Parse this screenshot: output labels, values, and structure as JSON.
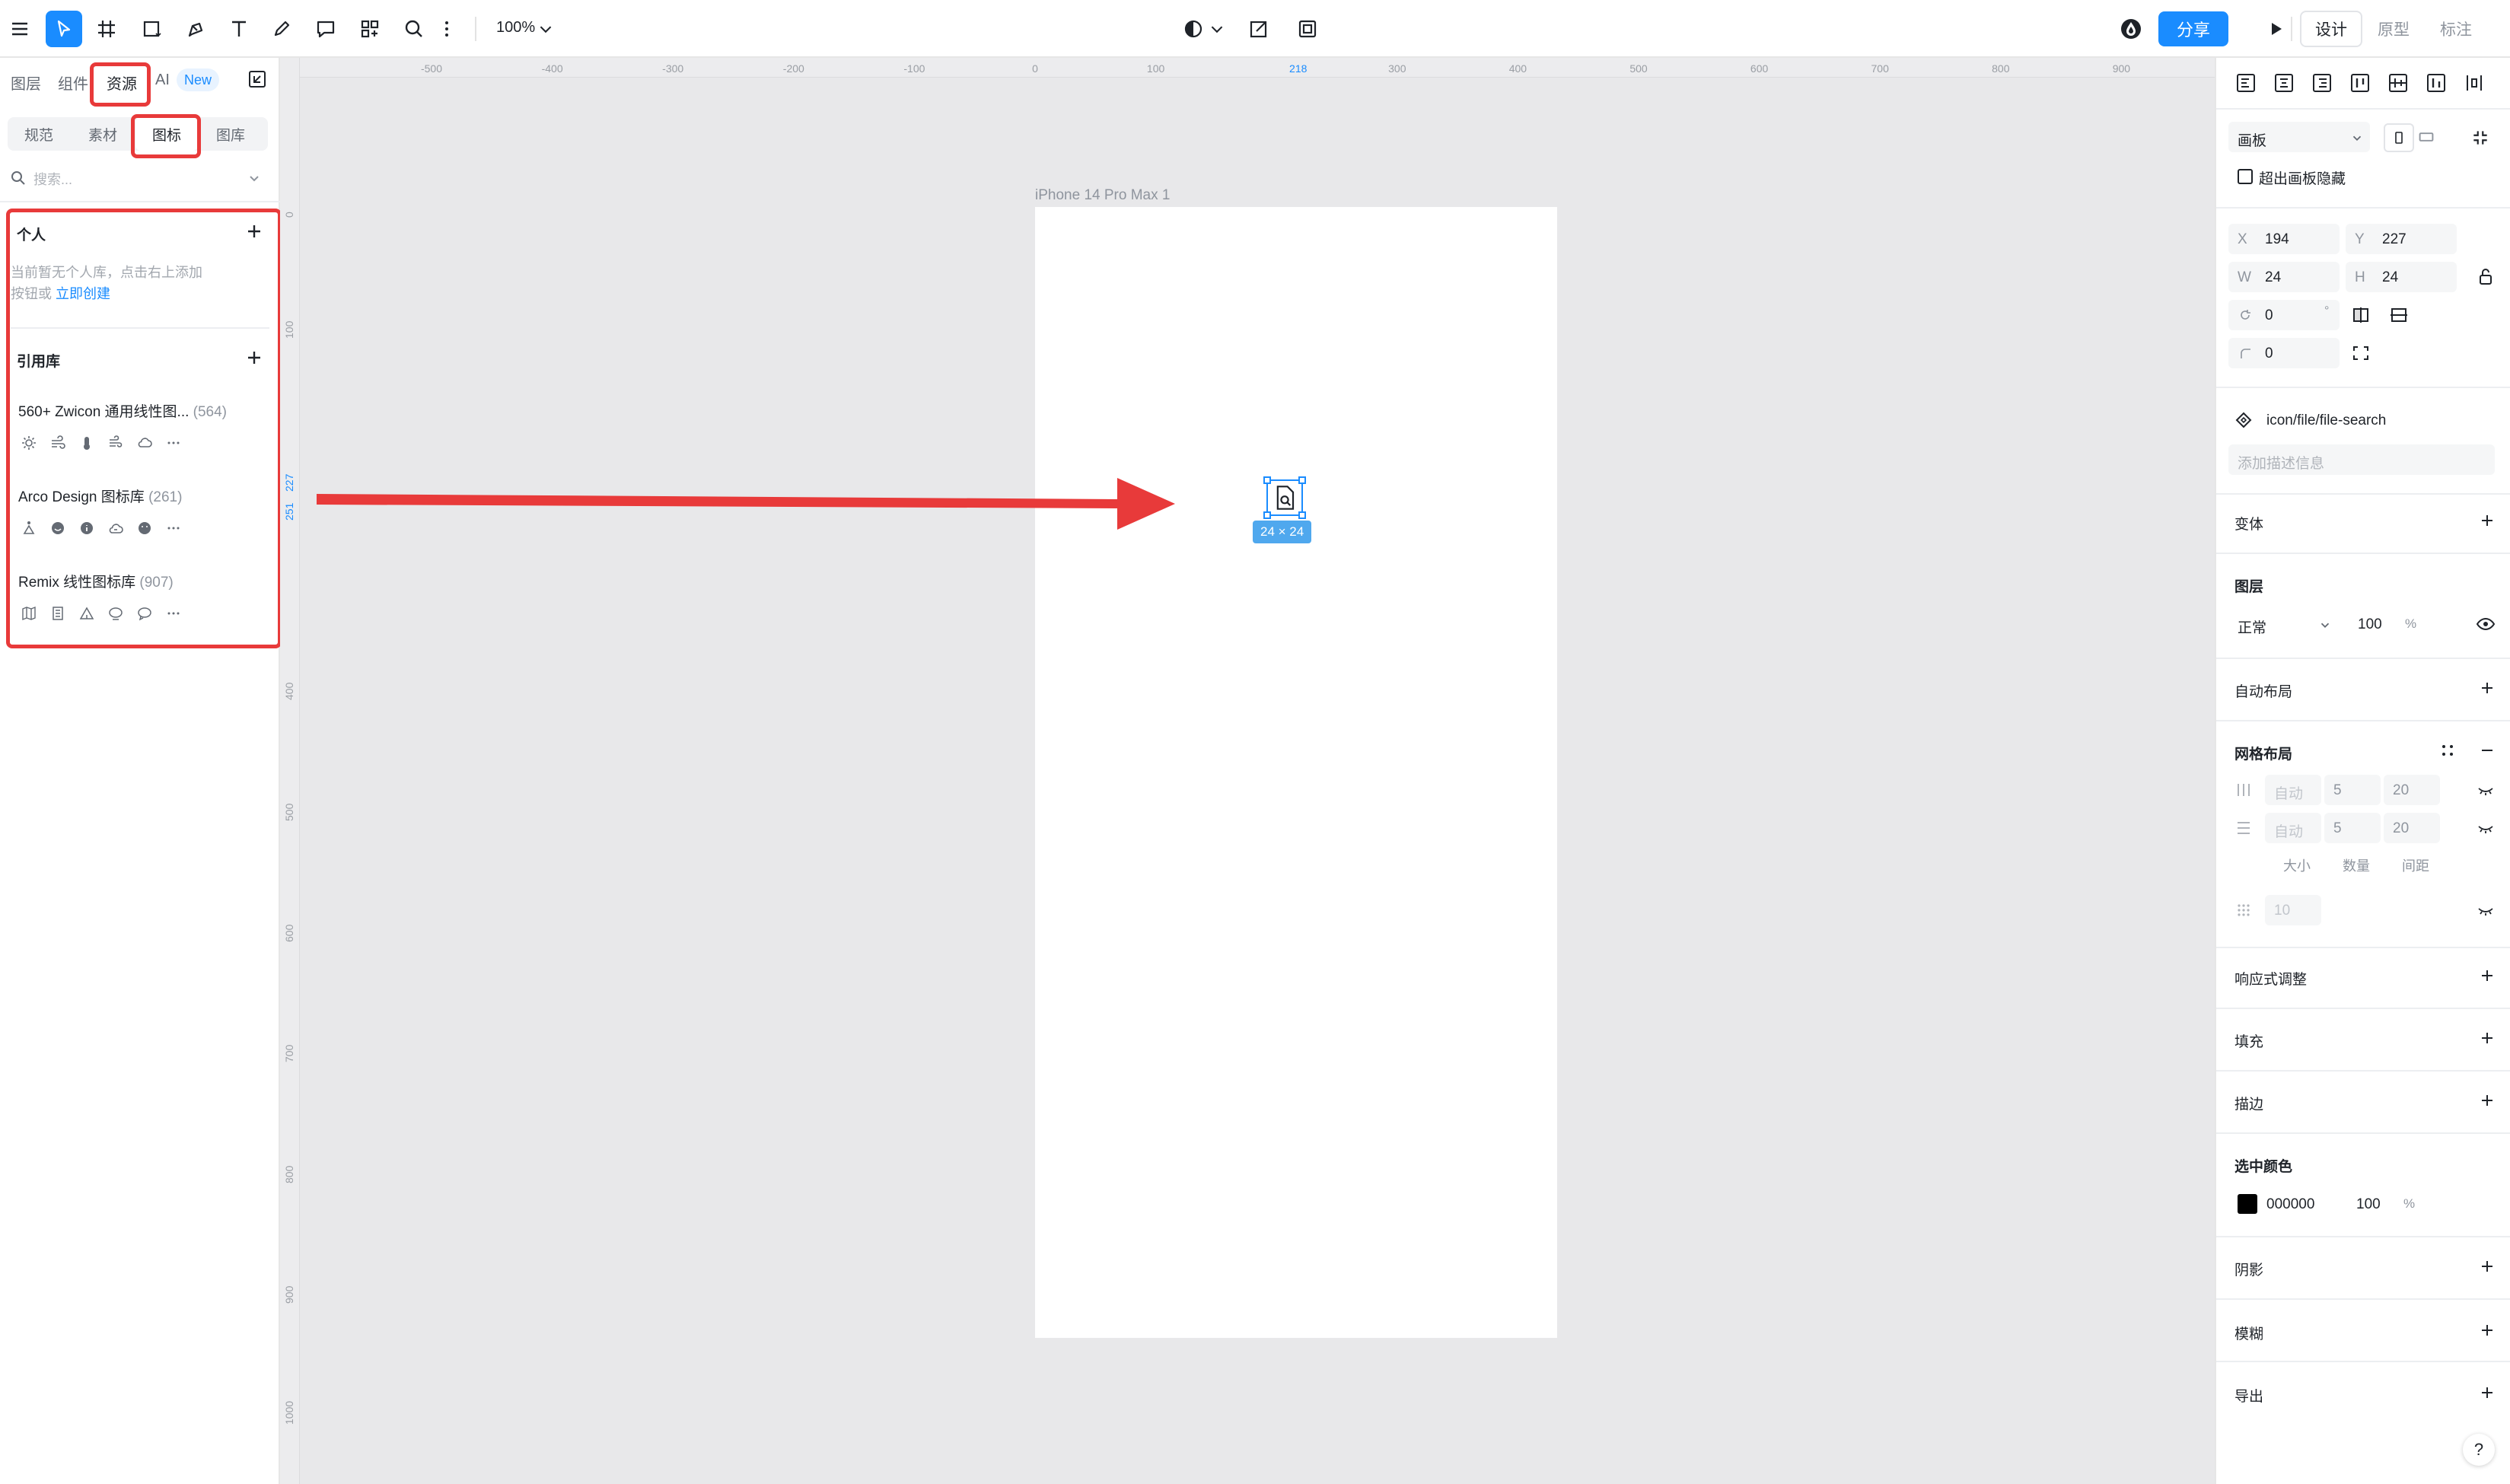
{
  "toolbar": {
    "zoom": "100%",
    "share_label": "分享",
    "modes": [
      "设计",
      "原型",
      "标注"
    ],
    "active_mode": "设计"
  },
  "left_panel": {
    "tabs": [
      "图层",
      "组件",
      "资源",
      "AI"
    ],
    "active_tab": "资源",
    "new_badge": "New",
    "sub_tabs": [
      "规范",
      "素材",
      "图标",
      "图库"
    ],
    "active_sub_tab": "图标",
    "search_placeholder": "搜索...",
    "personal": {
      "title": "个人",
      "empty_line1": "当前暂无个人库，点击右上添加",
      "empty_line2": "按钮或",
      "create_link": "立即创建"
    },
    "referenced": {
      "title": "引用库",
      "libraries": [
        {
          "name": "560+ Zwicon 通用线性图...",
          "count": "(564)"
        },
        {
          "name": "Arco Design 图标库",
          "count": "(261)"
        },
        {
          "name": "Remix 线性图标库",
          "count": "(907)"
        }
      ]
    }
  },
  "canvas": {
    "ruler_top": [
      "-500",
      "-400",
      "-300",
      "-200",
      "-100",
      "0",
      "100",
      "218",
      "300",
      "400",
      "500",
      "600",
      "700",
      "800",
      "900"
    ],
    "ruler_top_highlight": "218",
    "ruler_left": [
      "0",
      "100",
      "227",
      "251",
      "400",
      "500",
      "600",
      "700",
      "800",
      "900",
      "1000"
    ],
    "frame_name": "iPhone 14 Pro Max 1",
    "selection_size": "24 × 24",
    "accent_color": "#1a8cff",
    "annotation_color": "#e83a3a"
  },
  "right_panel": {
    "frame_type": "画板",
    "clip_content": "超出画板隐藏",
    "x_label": "X",
    "x": "194",
    "y_label": "Y",
    "y": "227",
    "w_label": "W",
    "w": "24",
    "h_label": "H",
    "h": "24",
    "rotation": "0",
    "rotation_unit": "°",
    "radius": "0",
    "component_name": "icon/file/file-search",
    "description_placeholder": "添加描述信息",
    "sections": {
      "variant": "变体",
      "layer": "图层",
      "auto_layout": "自动布局",
      "grid_layout": "网格布局",
      "responsive": "响应式调整",
      "fill": "填充",
      "stroke": "描边",
      "selected_colors": "选中颜色",
      "shadow": "阴影",
      "blur": "模糊",
      "export": "导出"
    },
    "layer_blend": "正常",
    "layer_opacity": "100",
    "percent": "%",
    "grid": {
      "col_auto": "自动",
      "col_count": "5",
      "col_gap": "20",
      "row_auto": "自动",
      "row_count": "5",
      "row_gap": "20",
      "labels": [
        "大小",
        "数量",
        "间距"
      ],
      "grid_size": "10"
    },
    "selected_color_hex": "000000",
    "selected_color_opacity": "100",
    "help": "?"
  }
}
